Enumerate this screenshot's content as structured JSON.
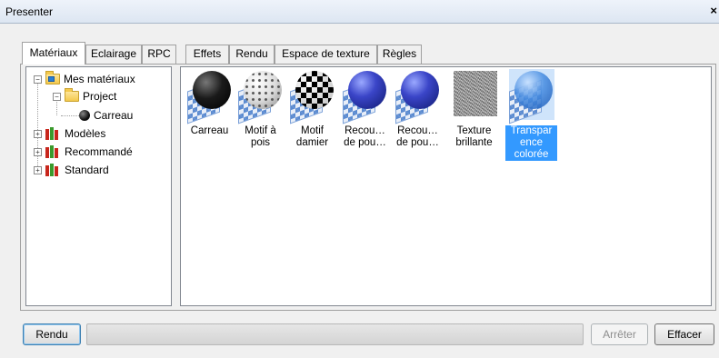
{
  "window": {
    "title": "Presenter",
    "close_glyph": "×"
  },
  "tabs": [
    {
      "label": "Matériaux",
      "active": true
    },
    {
      "label": "Eclairage"
    },
    {
      "label": "RPC"
    },
    {
      "label": "Effets"
    },
    {
      "label": "Rendu"
    },
    {
      "label": "Espace de texture"
    },
    {
      "label": "Règles"
    }
  ],
  "tree": {
    "items": [
      {
        "label": "Mes matériaux",
        "expander": "−",
        "icon": "folder-user-icon"
      },
      {
        "label": "Project",
        "expander": "−",
        "icon": "folder-icon"
      },
      {
        "label": "Carreau",
        "icon": "material-sphere-icon"
      },
      {
        "label": "Modèles",
        "expander": "+",
        "icon": "library-books-icon"
      },
      {
        "label": "Recommandé",
        "expander": "+",
        "icon": "library-books-icon"
      },
      {
        "label": "Standard",
        "expander": "+",
        "icon": "library-books-icon"
      }
    ]
  },
  "materials": [
    {
      "label": "Carreau",
      "icon": "black-sphere-icon"
    },
    {
      "label": "Motif à\npois",
      "icon": "dotted-sphere-icon"
    },
    {
      "label": "Motif\ndamier",
      "icon": "checker-sphere-icon"
    },
    {
      "label": "Recou…\nde pou…",
      "icon": "blue-sphere-icon"
    },
    {
      "label": "Recou…\nde pou…",
      "icon": "blue-sphere-icon"
    },
    {
      "label": "Texture\nbrillante",
      "icon": "noise-texture-icon"
    },
    {
      "label": "Transpar\nence\ncolorée",
      "icon": "transparent-sphere-icon",
      "selected": true
    }
  ],
  "footer": {
    "render_button": "Rendu",
    "stop_button": "Arrêter",
    "clear_button": "Effacer",
    "progress": 0
  },
  "colors": {
    "selection": "#3399ff",
    "book_red": "#c8261c",
    "book_green": "#3a9a2c"
  }
}
